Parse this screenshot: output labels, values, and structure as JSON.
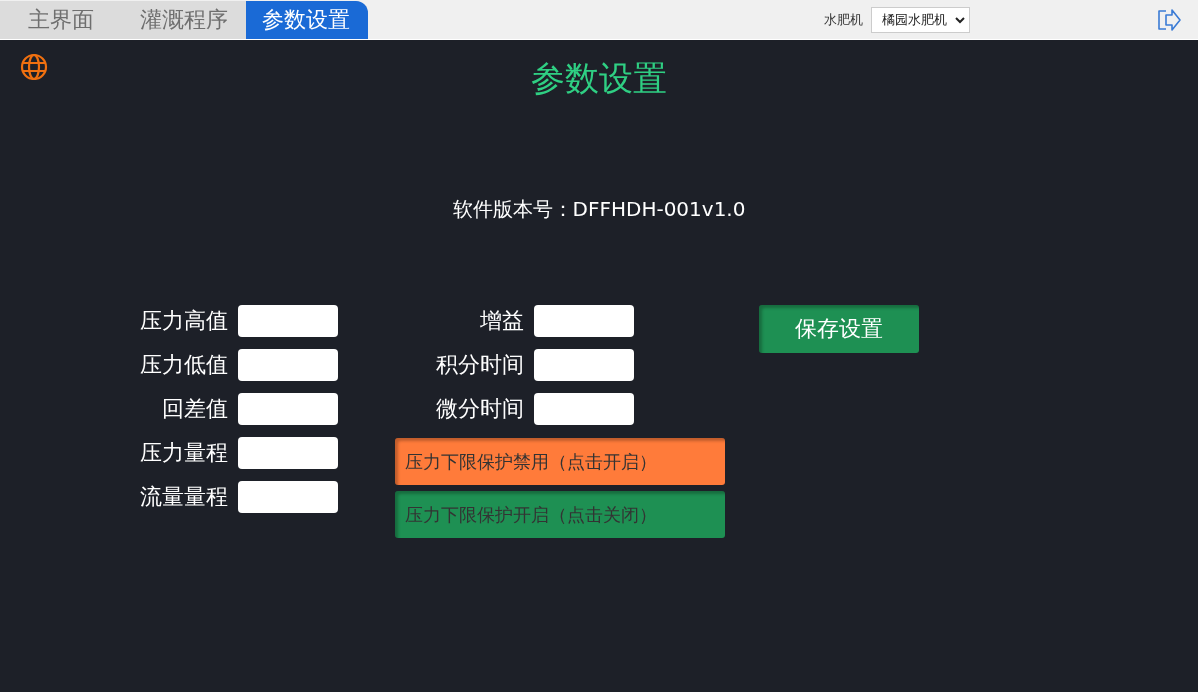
{
  "tabs": [
    {
      "label": "主界面",
      "selected": false
    },
    {
      "label": "灌溉程序",
      "selected": false
    },
    {
      "label": "参数设置",
      "selected": true
    }
  ],
  "device": {
    "label": "水肥机",
    "value": "橘园水肥机"
  },
  "title": "参数设置",
  "version": "软件版本号：DFFHDH-001v1.0",
  "left_fields": [
    {
      "label": "压力高值"
    },
    {
      "label": "压力低值"
    },
    {
      "label": "回差值"
    },
    {
      "label": "压力量程"
    },
    {
      "label": "流量量程"
    }
  ],
  "right_fields": [
    {
      "label": "增益"
    },
    {
      "label": "积分时间"
    },
    {
      "label": "微分时间"
    }
  ],
  "protection_buttons": [
    {
      "label": "压力下限保护禁用（点击开启）",
      "color": "#ff7b3a"
    },
    {
      "label": "压力下限保护开启（点击关闭）",
      "color": "#1e9053"
    }
  ],
  "save_button": "保存设置"
}
